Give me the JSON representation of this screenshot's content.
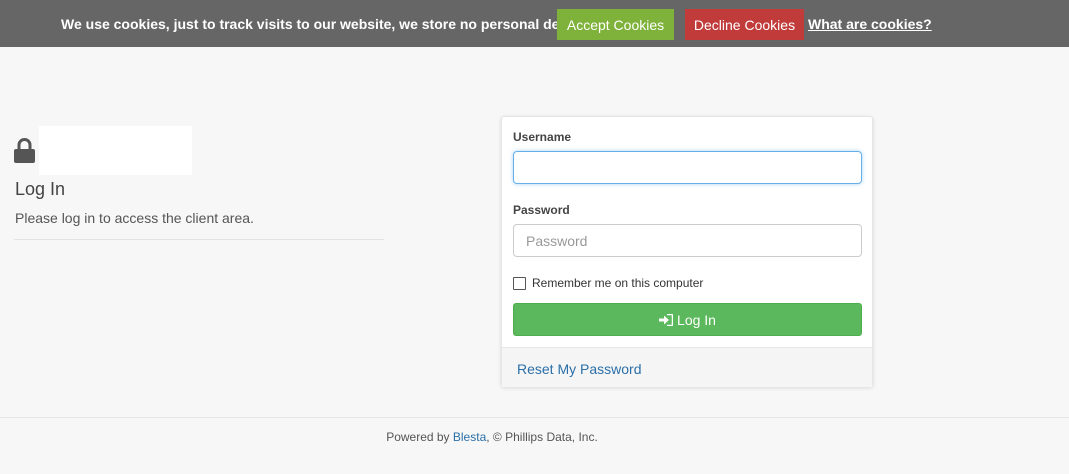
{
  "cookie_bar": {
    "message": "We use cookies, just to track visits to our website, we store no personal details.",
    "accept_label": "Accept Cookies",
    "decline_label": "Decline Cookies",
    "info_link": "What are cookies?",
    "colors": {
      "bar": "#666666",
      "accept": "#7fb23a",
      "decline": "#c13b3b"
    }
  },
  "header": {
    "title": "Log In",
    "subtitle": "Please log in to access the client area."
  },
  "login_form": {
    "username_label": "Username",
    "username_value": "",
    "password_label": "Password",
    "password_placeholder": "Password",
    "remember_label": "Remember me on this computer",
    "remember_checked": false,
    "submit_label": "Log In",
    "reset_link": "Reset My Password",
    "colors": {
      "submit": "#5cb85c",
      "link": "#2a6fa8"
    }
  },
  "footer": {
    "prefix": "Powered by ",
    "link": "Blesta",
    "suffix": ", © Phillips Data, Inc."
  }
}
